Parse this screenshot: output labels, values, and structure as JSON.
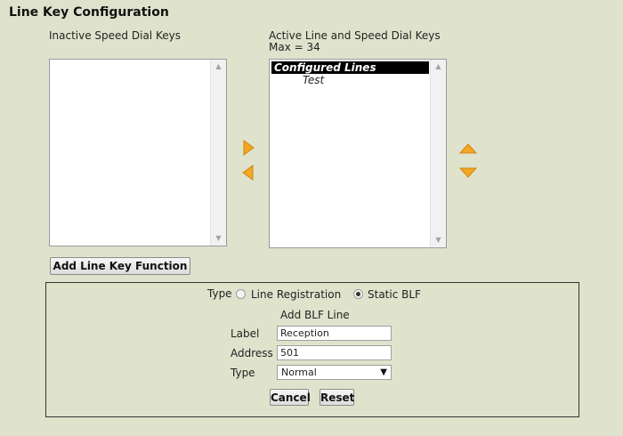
{
  "page": {
    "title": "Line Key Configuration"
  },
  "inactive": {
    "header": "Inactive Speed Dial Keys"
  },
  "active": {
    "header": "Active Line and Speed Dial Keys",
    "max": "Max = 34",
    "selected": "Configured Lines",
    "items": [
      "Test"
    ]
  },
  "buttons": {
    "add_function": "Add Line Key Function",
    "cancel": "Cancel",
    "reset": "Reset"
  },
  "form": {
    "type_label": "Type",
    "radio_line": "Line Registration",
    "radio_blf": "Static BLF",
    "radio_selected": "Static BLF",
    "section_title": "Add BLF Line",
    "label_label": "Label",
    "label_value": "Reception",
    "address_label": "Address",
    "address_value": "501",
    "type2_label": "Type",
    "type2_value": "Normal"
  },
  "colors": {
    "background": "#dfe3cc",
    "arrow_orange": "#f5a623",
    "selection": "#000000"
  },
  "icons": {
    "move_right": "triangle-right-icon",
    "move_left": "triangle-left-icon",
    "move_up": "triangle-up-icon",
    "move_down": "triangle-down-icon"
  }
}
